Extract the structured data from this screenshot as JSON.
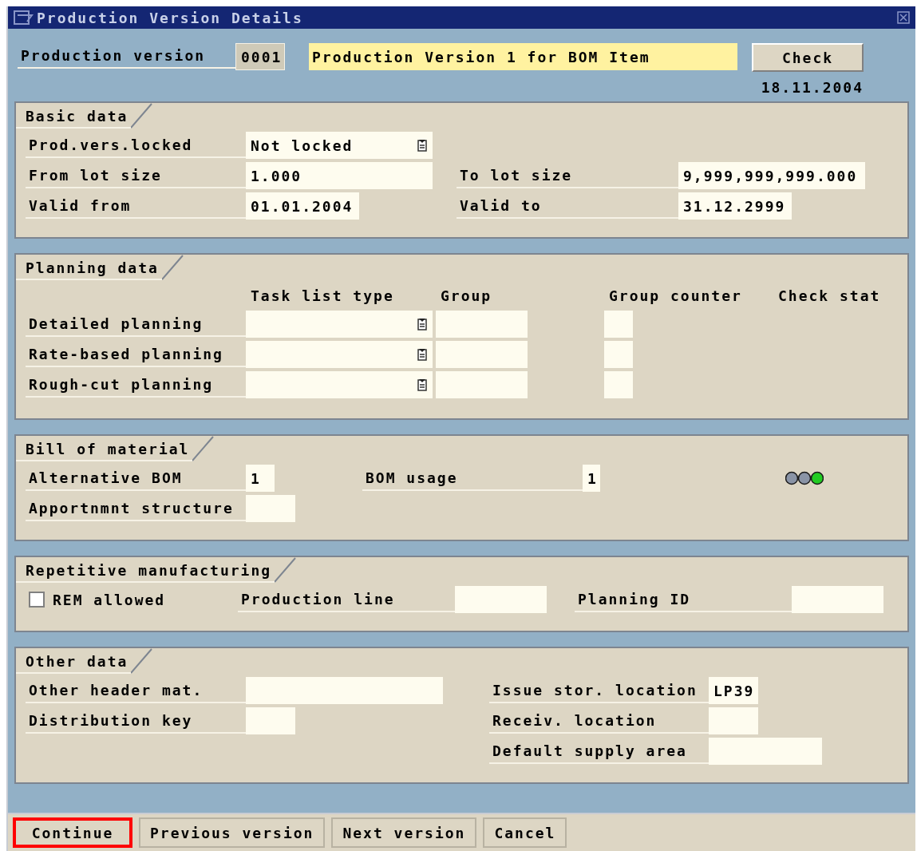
{
  "window": {
    "title": "Production Version Details"
  },
  "header": {
    "label": "Production version",
    "version": "0001",
    "description": "Production Version 1 for BOM Item",
    "check_button": "Check",
    "date": "18.11.2004"
  },
  "basic_data": {
    "title": "Basic data",
    "locked": {
      "label": "Prod.vers.locked",
      "value": "Not locked"
    },
    "from_lot": {
      "label": "From lot size",
      "value": "1.000"
    },
    "to_lot": {
      "label": "To lot size",
      "value": "9,999,999,999.000"
    },
    "valid_from": {
      "label": "Valid from",
      "value": "01.01.2004"
    },
    "valid_to": {
      "label": "Valid to",
      "value": "31.12.2999"
    }
  },
  "planning_data": {
    "title": "Planning data",
    "columns": [
      "Task list type",
      "Group",
      "Group counter",
      "Check stat"
    ],
    "rows": [
      {
        "label": "Detailed planning"
      },
      {
        "label": "Rate-based planning"
      },
      {
        "label": "Rough-cut planning"
      }
    ]
  },
  "bill_of_material": {
    "title": "Bill of material",
    "alternative_bom": {
      "label": "Alternative BOM",
      "value": "1"
    },
    "bom_usage": {
      "label": "BOM usage",
      "value": "1"
    },
    "status_lights": [
      {
        "on": false
      },
      {
        "on": false
      },
      {
        "on": true
      }
    ],
    "apportionment": {
      "label": "Apportnmnt structure"
    }
  },
  "repetitive": {
    "title": "Repetitive manufacturing",
    "rem_allowed": {
      "label": "REM allowed",
      "checked": false
    },
    "production_line": {
      "label": "Production line"
    },
    "planning_id": {
      "label": "Planning ID"
    }
  },
  "other_data": {
    "title": "Other data",
    "other_header_mat": {
      "label": "Other header mat."
    },
    "distribution_key": {
      "label": "Distribution key"
    },
    "issue_location": {
      "label": "Issue stor. location",
      "value": "LP39"
    },
    "receiving_location": {
      "label": "Receiv. location"
    },
    "supply_area": {
      "label": "Default supply area"
    }
  },
  "buttons": [
    {
      "label": "Continue",
      "highlighted": true
    },
    {
      "label": "Previous version",
      "highlighted": false
    },
    {
      "label": "Next version",
      "highlighted": false
    },
    {
      "label": "Cancel",
      "highlighted": false
    }
  ]
}
